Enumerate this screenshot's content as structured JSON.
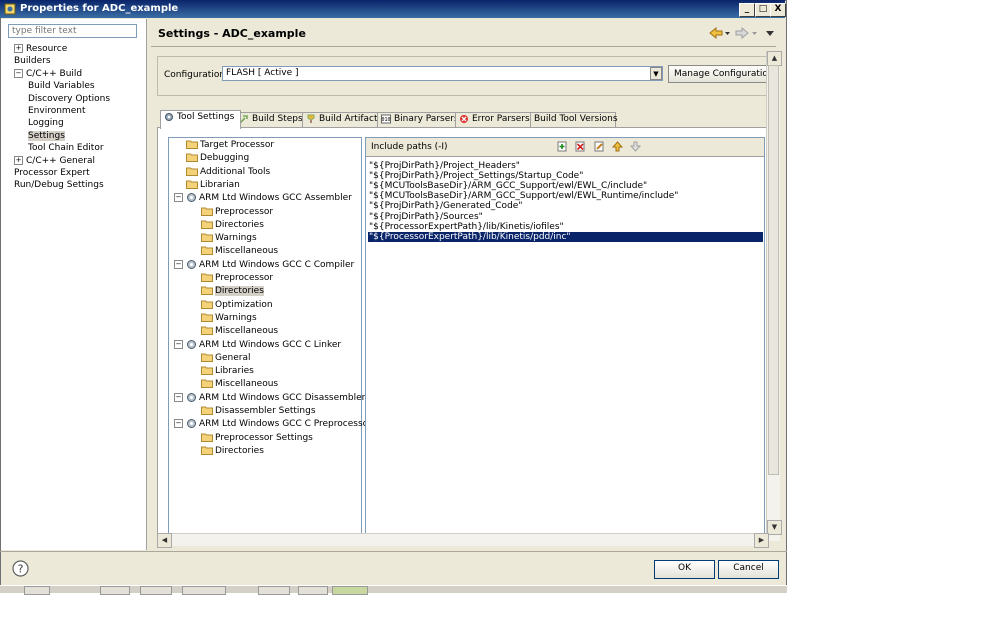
{
  "window": {
    "title": "Properties for ADC_example",
    "minimize": "_",
    "maximize": "□",
    "close": "X"
  },
  "filter": {
    "placeholder": "type filter text"
  },
  "nav": {
    "items": [
      {
        "label": "Resource",
        "expander": "+"
      },
      {
        "label": "Builders"
      },
      {
        "label": "C/C++ Build",
        "expander": "−"
      },
      {
        "label": "Build Variables"
      },
      {
        "label": "Discovery Options"
      },
      {
        "label": "Environment"
      },
      {
        "label": "Logging"
      },
      {
        "label": "Settings"
      },
      {
        "label": "Tool Chain Editor"
      },
      {
        "label": "C/C++ General",
        "expander": "+"
      },
      {
        "label": "Processor Expert"
      },
      {
        "label": "Run/Debug Settings"
      }
    ]
  },
  "header": {
    "title": "Settings - ADC_example"
  },
  "config": {
    "label": "Configuration:",
    "value": "FLASH  [ Active ]",
    "manage_label": "Manage Configurations..."
  },
  "tabs": [
    {
      "label": "Tool Settings"
    },
    {
      "label": "Build Steps"
    },
    {
      "label": "Build Artifact"
    },
    {
      "label": "Binary Parsers"
    },
    {
      "label": "Error Parsers"
    },
    {
      "label": "Build Tool Versions"
    }
  ],
  "tool_tree": [
    {
      "label": "Target Processor"
    },
    {
      "label": "Debugging"
    },
    {
      "label": "Additional Tools"
    },
    {
      "label": "Librarian"
    },
    {
      "label": "ARM Ltd Windows GCC Assembler",
      "expander": "−"
    },
    {
      "label": "Preprocessor"
    },
    {
      "label": "Directories"
    },
    {
      "label": "Warnings"
    },
    {
      "label": "Miscellaneous"
    },
    {
      "label": "ARM Ltd Windows GCC C Compiler",
      "expander": "−"
    },
    {
      "label": "Preprocessor"
    },
    {
      "label": "Directories"
    },
    {
      "label": "Optimization"
    },
    {
      "label": "Warnings"
    },
    {
      "label": "Miscellaneous"
    },
    {
      "label": "ARM Ltd Windows GCC C Linker",
      "expander": "−"
    },
    {
      "label": "General"
    },
    {
      "label": "Libraries"
    },
    {
      "label": "Miscellaneous"
    },
    {
      "label": "ARM Ltd Windows GCC Disassembler",
      "expander": "−"
    },
    {
      "label": "Disassembler Settings"
    },
    {
      "label": "ARM Ltd Windows GCC C Preprocessor",
      "expander": "−"
    },
    {
      "label": "Preprocessor Settings"
    },
    {
      "label": "Directories"
    }
  ],
  "include": {
    "label": "Include paths (-I)",
    "paths": [
      "\"${ProjDirPath}/Project_Headers\"",
      "\"${ProjDirPath}/Project_Settings/Startup_Code\"",
      "\"${MCUToolsBaseDir}/ARM_GCC_Support/ewl/EWL_C/include\"",
      "\"${MCUToolsBaseDir}/ARM_GCC_Support/ewl/EWL_Runtime/include\"",
      "\"${ProjDirPath}/Generated_Code\"",
      "\"${ProjDirPath}/Sources\"",
      "\"${ProcessorExpertPath}/lib/Kinetis/iofiles\"",
      "\"${ProcessorExpertPath}/lib/Kinetis/pdd/inc\""
    ]
  },
  "buttons": {
    "ok": "OK",
    "cancel": "Cancel"
  },
  "help": {
    "glyph": "?"
  }
}
